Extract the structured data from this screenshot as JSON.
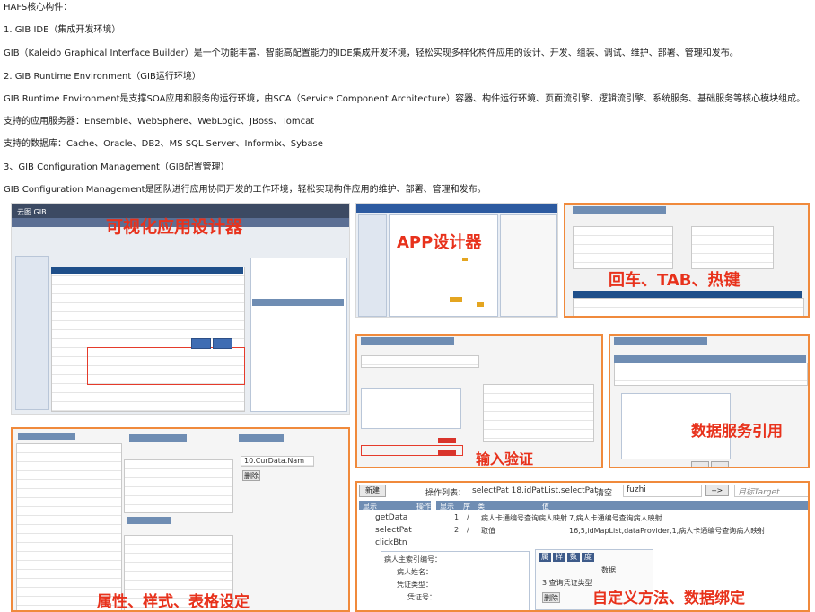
{
  "text": {
    "title": "HAFS核心构件：",
    "s1_heading": "1. GIB IDE（集成开发环境）",
    "s1_desc": "GIB（Kaleido Graphical Interface Builder）是一个功能丰富、智能高配置能力的IDE集成开发环境，轻松实现多样化构件应用的设计、开发、组装、调试、维护、部署、管理和发布。",
    "s2_heading": "2. GIB Runtime Environment（GIB运行环境）",
    "s2_desc": "GIB Runtime Environment是支撑SOA应用和服务的运行环境，由SCA（Service Component Architecture）容器、构件运行环境、页面流引擎、逻辑流引擎、系统服务、基础服务等核心模块组成。",
    "app_servers": "支持的应用服务器：Ensemble、WebSphere、WebLogic、JBoss、Tomcat",
    "databases": "支持的数据库：Cache、Oracle、DB2、MS SQL Server、Informix、Sybase",
    "s3_heading": "3、GIB Configuration Management（GIB配置管理）",
    "s3_desc": "GIB Configuration Management是团队进行应用协同开发的工作环境，轻松实现构件应用的维护、部署、管理和发布。"
  },
  "captions": {
    "visual_design": "可视化应用设计器",
    "app_designer": "APP设计器",
    "hotkeys": "回车、TAB、热键",
    "input_validation": "输入验证",
    "data_service": "数据服务引用",
    "properties": "属性、样式、表格设定",
    "custom_binding": "自定义方法、数据绑定"
  },
  "screens": {
    "gib_app_title": "云图 GIB",
    "data_tab": "数据",
    "delete_label": "删除",
    "cur_data": "10.CurData.Nam",
    "ops_label": "操作列表：",
    "ops_value": "selectPat 18.idPatList.selectPat",
    "clear_label": "清空",
    "fuzhi": "fuzhi",
    "target": "目标Target",
    "new_label": "新建",
    "show_col": "显示",
    "op_col": "操作",
    "seq_col": "序",
    "type_col": "类",
    "value_col": "值",
    "method_get": "getData",
    "method_select": "selectPat",
    "method_click": "clickBtn",
    "row1_seq": "1",
    "row1_type": "/",
    "row1_text": "病人卡通编号查询病人映射",
    "row1_value": "7,病人卡通编号查询病人映射",
    "row2_seq": "2",
    "row2_type": "/",
    "row2_text": "取值",
    "row2_value": "16,5,idMapList,dataProvider,1,病人卡通编号查询病人映射",
    "form_id": "病人主索引编号：",
    "form_name": "病人姓名：",
    "form_cert": "凭证类型：",
    "form_certno": "凭证号：",
    "bind_data": "数据",
    "bind_cert": "3.查询凭证类型",
    "bind_delete": "删除",
    "tab_a": "属",
    "tab_b": "样",
    "tab_c": "数",
    "tab_d": "度",
    "arrow": "-->"
  }
}
